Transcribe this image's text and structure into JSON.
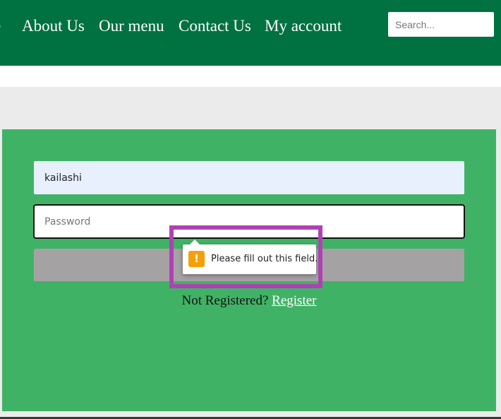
{
  "nav": {
    "items": [
      {
        "label": "e"
      },
      {
        "label": "About Us"
      },
      {
        "label": "Our menu"
      },
      {
        "label": "Contact Us"
      },
      {
        "label": "My account"
      }
    ],
    "search": {
      "placeholder": "Search..."
    }
  },
  "login": {
    "username": {
      "value": "kailashi"
    },
    "password": {
      "placeholder": "Password",
      "value": ""
    },
    "submit_label": "",
    "validation": {
      "icon": "warning-icon",
      "glyph": "!",
      "message": "Please fill out this field."
    },
    "register_prompt": "Not Registered?",
    "register_link": "Register"
  },
  "colors": {
    "navbar": "#007140",
    "panel": "#40b266",
    "button": "#a5a2a3",
    "highlight": "#b041b5",
    "warning": "#f5a00a"
  }
}
